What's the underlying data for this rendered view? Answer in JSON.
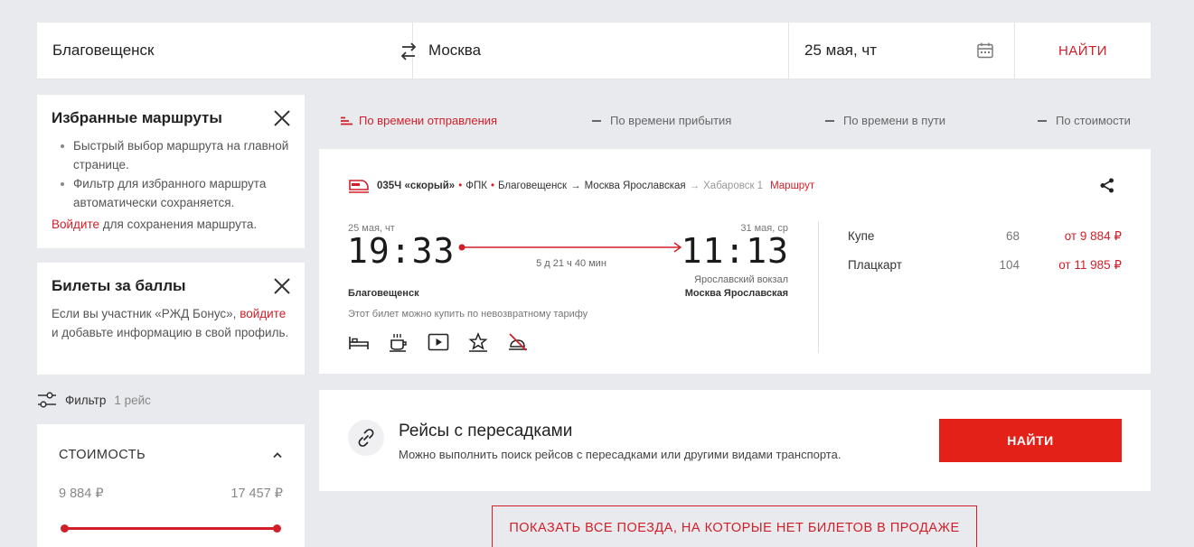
{
  "search": {
    "from": "Благовещенск",
    "to": "Москва",
    "date": "25 мая, чт",
    "find_label": "НАЙТИ"
  },
  "favorites": {
    "title": "Избранные маршруты",
    "items": [
      "Быстрый выбор маршрута на главной странице.",
      "Фильтр для избранного маршрута автоматически сохраняется."
    ],
    "login_link": "Войдите",
    "login_suffix": " для сохранения маршрута."
  },
  "bonus": {
    "title": "Билеты за баллы",
    "text_prefix": "Если вы участник «РЖД Бонус», ",
    "login_link": "войдите",
    "text_suffix": " и добавьте информацию в свой профиль."
  },
  "filter": {
    "label": "Фильтр",
    "count": "1 рейс"
  },
  "price_filter": {
    "title": "СТОИМОСТЬ",
    "min": "9 884 ₽",
    "max": "17 457 ₽"
  },
  "sort": {
    "tabs": [
      {
        "label": "По времени отправления",
        "active": true
      },
      {
        "label": "По времени прибытия",
        "active": false
      },
      {
        "label": "По времени в пути",
        "active": false
      },
      {
        "label": "По стоимости",
        "active": false
      }
    ]
  },
  "train": {
    "number": "035Ч «скорый»",
    "carrier": "ФПК",
    "route_from": "Благовещенск",
    "route_to": "Москва Ярославская",
    "route_next": "Хабаровск 1",
    "route_link": "Маршрут",
    "departure_date": "25 мая, чт",
    "departure_time": "19:33",
    "arrival_date": "31 мая, ср",
    "arrival_time": "11:13",
    "duration": "5 д 21 ч 40 мин",
    "arrival_station": "Ярославский вокзал",
    "departure_city": "Благовещенск",
    "arrival_city": "Москва Ярославская",
    "tariff_note": "Этот билет можно купить по невозвратному тарифу",
    "classes": [
      {
        "name": "Купе",
        "seats": "68",
        "price": "от 9 884 ₽"
      },
      {
        "name": "Плацкарт",
        "seats": "104",
        "price": "от 11 985 ₽"
      }
    ]
  },
  "transfers": {
    "title": "Рейсы с пересадками",
    "description": "Можно выполнить поиск рейсов с пересадками или другими видами транспорта.",
    "button": "НАЙТИ"
  },
  "show_all_label": "ПОКАЗАТЬ ВСЕ ПОЕЗДА, НА КОТОРЫЕ НЕТ БИЛЕТОВ В ПРОДАЖЕ",
  "colors": {
    "accent": "#d11f29",
    "button": "#e32119",
    "background": "#e9eaee"
  }
}
